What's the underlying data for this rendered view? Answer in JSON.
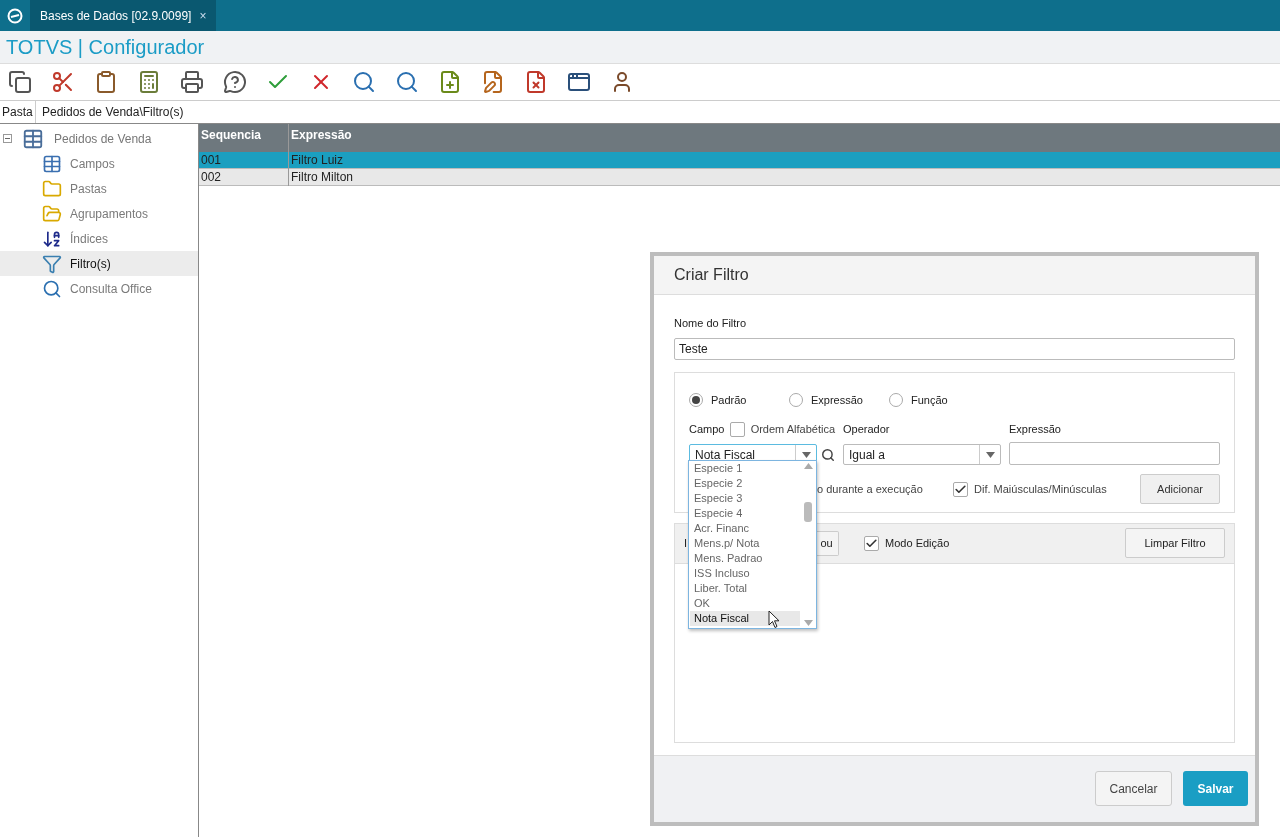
{
  "app_tab": {
    "title": "Bases de Dados [02.9.0099]",
    "close": "×"
  },
  "app_title": "TOTVS | Configurador",
  "path_bar": {
    "label": "Pasta",
    "value": "Pedidos de Venda\\Filtro(s)"
  },
  "tree": {
    "label": "Pedidos de Venda",
    "expanded": true,
    "children": [
      {
        "label": "Campos",
        "selected": false
      },
      {
        "label": "Pastas",
        "selected": false
      },
      {
        "label": "Agrupamentos",
        "selected": false
      },
      {
        "label": "Índices",
        "selected": false
      },
      {
        "label": "Filtro(s)",
        "selected": true
      },
      {
        "label": "Consulta Office",
        "selected": false
      }
    ]
  },
  "table": {
    "columns": [
      "Sequencia",
      "Expressão"
    ],
    "rows": [
      {
        "cells": [
          "001",
          "Filtro Luiz"
        ],
        "selected": true
      },
      {
        "cells": [
          "002",
          "Filtro Milton"
        ],
        "selected": false
      }
    ]
  },
  "dialog": {
    "title": "Criar Filtro",
    "name_label": "Nome do Filtro",
    "name_value": "Teste",
    "modes": [
      {
        "label": "Padrão",
        "selected": true
      },
      {
        "label": "Expressão",
        "selected": false
      },
      {
        "label": "Função",
        "selected": false
      }
    ],
    "field_label": "Campo",
    "alpha_order": {
      "label": "Ordem Alfabética",
      "checked": false
    },
    "field_value": "Nota Fiscal",
    "operator_label": "Operador",
    "operator_value": "Igual a",
    "expression_label": "Expressão",
    "field_options": [
      {
        "label": "Especie 1",
        "selected": false
      },
      {
        "label": "Especie 2",
        "selected": false
      },
      {
        "label": "Especie 3",
        "selected": false
      },
      {
        "label": "Especie 4",
        "selected": false
      },
      {
        "label": "Acr. Financ",
        "selected": false
      },
      {
        "label": "Mens.p/ Nota",
        "selected": false
      },
      {
        "label": "Mens. Padrao",
        "selected": false
      },
      {
        "label": "ISS Incluso",
        "selected": false
      },
      {
        "label": "Liber. Total",
        "selected": false
      },
      {
        "label": "OK",
        "selected": false
      },
      {
        "label": "Nota Fiscal",
        "selected": true
      }
    ],
    "runtime_option_text": "o durante a execução",
    "case_sensitive": {
      "label": "Dif. Maiúsculas/Minúsculas",
      "checked": true
    },
    "add_button": "Adicionar",
    "filter_bar_label": "I",
    "or_button": "ou",
    "edit_mode": {
      "label": "Modo Edição",
      "checked": true
    },
    "clear_button": "Limpar Filtro",
    "cancel_button": "Cancelar",
    "save_button": "Salvar"
  }
}
